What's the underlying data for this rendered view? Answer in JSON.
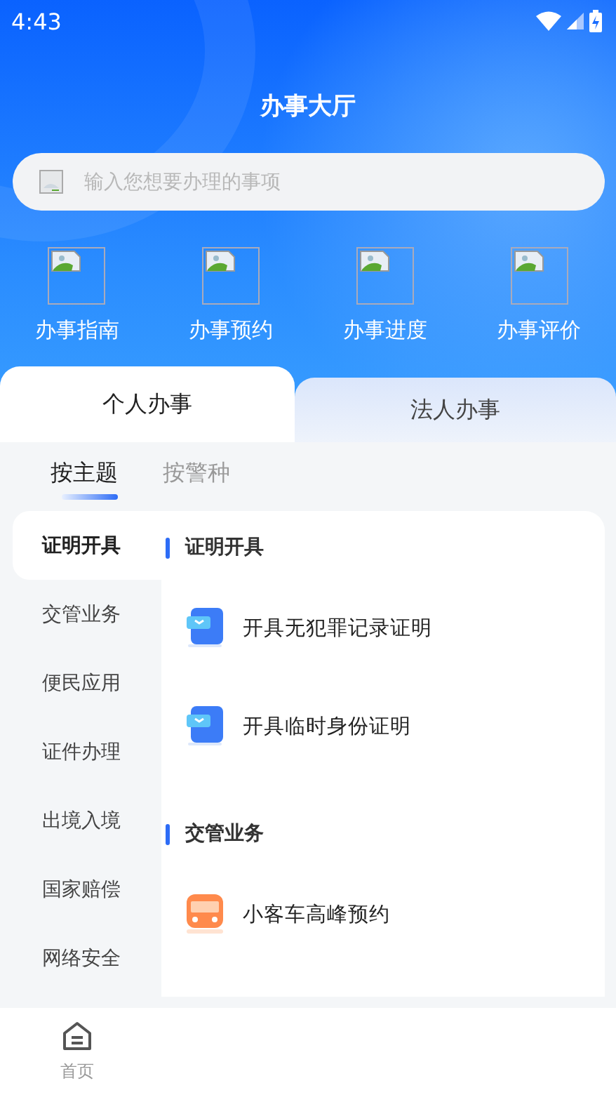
{
  "status_bar": {
    "time": "4:43"
  },
  "header": {
    "title": "办事大厅"
  },
  "search": {
    "placeholder": "输入您想要办理的事项"
  },
  "shortcuts": [
    {
      "label": "办事指南"
    },
    {
      "label": "办事预约"
    },
    {
      "label": "办事进度"
    },
    {
      "label": "办事评价"
    }
  ],
  "tabs": [
    {
      "label": "个人办事",
      "selected": true
    },
    {
      "label": "法人办事",
      "selected": false
    }
  ],
  "subtabs": [
    {
      "label": "按主题",
      "selected": true
    },
    {
      "label": "按警种",
      "selected": false
    }
  ],
  "categories": [
    {
      "label": "证明开具",
      "selected": true
    },
    {
      "label": "交管业务",
      "selected": false
    },
    {
      "label": "便民应用",
      "selected": false
    },
    {
      "label": "证件办理",
      "selected": false
    },
    {
      "label": "出境入境",
      "selected": false
    },
    {
      "label": "国家赔偿",
      "selected": false
    },
    {
      "label": "网络安全",
      "selected": false
    }
  ],
  "sections": [
    {
      "title": "证明开具",
      "items": [
        {
          "label": "开具无犯罪记录证明",
          "kind": "certificate"
        },
        {
          "label": "开具临时身份证明",
          "kind": "certificate"
        }
      ]
    },
    {
      "title": "交管业务",
      "items": [
        {
          "label": "小客车高峰预约",
          "kind": "car"
        }
      ]
    }
  ],
  "bottom_nav": [
    {
      "label": "首页",
      "selected": false
    }
  ]
}
